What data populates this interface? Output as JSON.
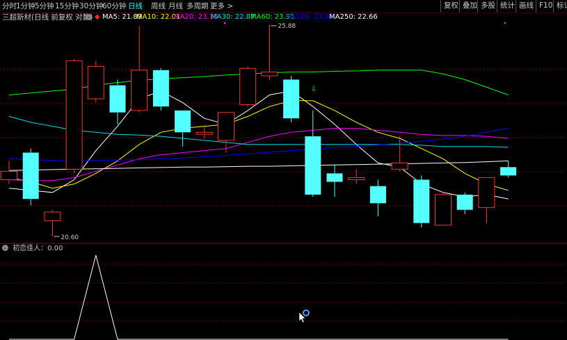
{
  "toolbar": {
    "periods": [
      "分时",
      "1分钟",
      "5分钟",
      "15分钟",
      "30分钟",
      "60分钟",
      "日线",
      "周线",
      "月线",
      "多周期",
      "更多 >"
    ],
    "active_period": "日线",
    "right_buttons": [
      "复权",
      "叠加",
      "多股",
      "统计",
      "画线",
      "F10",
      "标记"
    ]
  },
  "header": {
    "stock_title": "三超新材(日线 前复权 对数)",
    "ma": [
      {
        "label": "MA5: 21.89",
        "color": "#ffffff"
      },
      {
        "label": "MA10: 22.01",
        "color": "#ffff00"
      },
      {
        "label": "MA20: 23.10",
        "color": "#ff00ff"
      },
      {
        "label": "MA30: 22.87",
        "color": "#00e0e0"
      },
      {
        "label": "MA60: 23.91",
        "color": "#00ff00"
      },
      {
        "label": "MA120: 23.96",
        "color": "#0000ff"
      },
      {
        "label": "MA250: 22.66",
        "color": "#ffffff"
      }
    ]
  },
  "colors": {
    "up": "#ff3030",
    "down": "#54ffff",
    "grid": "#7a0000"
  },
  "chart_data": {
    "type": "candlestick",
    "price_axis": "log",
    "max_label": "25.88",
    "min_label": "20.60",
    "candles": [
      {
        "o": 21.9,
        "c": 22.1,
        "h": 22.35,
        "l": 21.8,
        "dir": "up"
      },
      {
        "o": 22.55,
        "c": 21.45,
        "h": 22.65,
        "l": 21.3,
        "dir": "down"
      },
      {
        "o": 20.95,
        "c": 21.15,
        "h": 21.2,
        "l": 20.6,
        "dir": "up"
      },
      {
        "o": 22.15,
        "c": 24.9,
        "h": 24.95,
        "l": 22.05,
        "dir": "up"
      },
      {
        "o": 23.9,
        "c": 24.75,
        "h": 24.9,
        "l": 23.8,
        "dir": "up"
      },
      {
        "o": 24.25,
        "c": 23.55,
        "h": 24.4,
        "l": 23.25,
        "dir": "down"
      },
      {
        "o": 23.6,
        "c": 24.65,
        "h": 25.85,
        "l": 23.55,
        "dir": "up"
      },
      {
        "o": 24.65,
        "c": 23.7,
        "h": 24.7,
        "l": 23.6,
        "dir": "down"
      },
      {
        "o": 23.6,
        "c": 23.05,
        "h": 23.6,
        "l": 22.7,
        "dir": "down"
      },
      {
        "o": 23.0,
        "c": 23.05,
        "h": 23.2,
        "l": 22.9,
        "dir": "up"
      },
      {
        "o": 22.85,
        "c": 23.55,
        "h": 23.55,
        "l": 22.55,
        "dir": "up"
      },
      {
        "o": 23.75,
        "c": 24.7,
        "h": 24.75,
        "l": 23.7,
        "dir": "up"
      },
      {
        "o": 24.5,
        "c": 24.6,
        "h": 25.88,
        "l": 24.4,
        "dir": "up"
      },
      {
        "o": 24.4,
        "c": 23.4,
        "h": 24.5,
        "l": 23.3,
        "dir": "down"
      },
      {
        "o": 22.95,
        "c": 21.55,
        "h": 23.6,
        "l": 21.5,
        "dir": "down"
      },
      {
        "o": 22.05,
        "c": 21.85,
        "h": 22.25,
        "l": 21.5,
        "dir": "down"
      },
      {
        "o": 21.9,
        "c": 21.95,
        "h": 22.15,
        "l": 21.8,
        "dir": "up"
      },
      {
        "o": 21.75,
        "c": 21.35,
        "h": 21.9,
        "l": 21.05,
        "dir": "down"
      },
      {
        "o": 22.15,
        "c": 22.3,
        "h": 22.95,
        "l": 22.1,
        "dir": "up"
      },
      {
        "o": 21.9,
        "c": 20.9,
        "h": 22.0,
        "l": 20.8,
        "dir": "down"
      },
      {
        "o": 20.85,
        "c": 21.55,
        "h": 21.6,
        "l": 20.85,
        "dir": "up"
      },
      {
        "o": 21.55,
        "c": 21.2,
        "h": 21.6,
        "l": 21.1,
        "dir": "down"
      },
      {
        "o": 21.25,
        "c": 21.95,
        "h": 21.95,
        "l": 20.9,
        "dir": "up"
      },
      {
        "o": 22.2,
        "c": 22.0,
        "h": 22.35,
        "l": 21.95,
        "dir": "down"
      }
    ],
    "ma_lines": [
      {
        "name": "MA5",
        "color": "#ffffff",
        "values": [
          21.7,
          21.65,
          21.6,
          21.9,
          22.6,
          23.2,
          23.9,
          24.1,
          23.8,
          23.4,
          23.25,
          23.6,
          24.0,
          24.1,
          23.7,
          23.25,
          22.75,
          22.3,
          22.2,
          21.8,
          21.6,
          21.5,
          21.55,
          21.45
        ]
      },
      {
        "name": "MA10",
        "color": "#ffff00",
        "values": [
          21.95,
          21.85,
          21.7,
          21.8,
          22.05,
          22.35,
          22.75,
          23.05,
          23.15,
          23.2,
          23.25,
          23.45,
          23.7,
          23.85,
          23.85,
          23.6,
          23.3,
          23.05,
          22.9,
          22.65,
          22.4,
          22.05,
          21.8,
          21.65
        ]
      },
      {
        "name": "MA20",
        "color": "#ff00ff",
        "values": [
          21.9,
          21.88,
          21.88,
          21.95,
          22.1,
          22.25,
          22.4,
          22.5,
          22.55,
          22.6,
          22.65,
          22.8,
          22.95,
          23.05,
          23.1,
          23.15,
          23.15,
          23.1,
          23.05,
          23.0,
          22.97,
          22.97,
          22.95,
          22.9
        ]
      },
      {
        "name": "MA30",
        "color": "#00e0e0",
        "values": [
          23.45,
          23.3,
          23.2,
          23.1,
          23.05,
          23.0,
          22.98,
          22.95,
          22.9,
          22.85,
          22.8,
          22.75,
          22.75,
          22.75,
          22.75,
          22.75,
          22.75,
          22.75,
          22.75,
          22.73,
          22.7,
          22.7,
          22.7,
          22.68
        ]
      },
      {
        "name": "MA60",
        "color": "#00ff00",
        "values": [
          24.0,
          24.05,
          24.1,
          24.15,
          24.25,
          24.32,
          24.38,
          24.42,
          24.45,
          24.48,
          24.52,
          24.55,
          24.58,
          24.6,
          24.6,
          24.62,
          24.63,
          24.65,
          24.65,
          24.65,
          24.55,
          24.4,
          24.2,
          24.0
        ]
      },
      {
        "name": "MA120",
        "color": "#0000ff",
        "values": [
          22.4,
          22.38,
          22.36,
          22.35,
          22.36,
          22.37,
          22.38,
          22.4,
          22.42,
          22.45,
          22.48,
          22.52,
          22.56,
          22.6,
          22.63,
          22.67,
          22.7,
          22.74,
          22.78,
          22.83,
          22.88,
          22.95,
          23.05,
          23.15
        ]
      },
      {
        "name": "MA250",
        "color": "#ffffff",
        "values": [
          22.12,
          22.13,
          22.14,
          22.15,
          22.16,
          22.17,
          22.18,
          22.19,
          22.2,
          22.2,
          22.21,
          22.22,
          22.22,
          22.23,
          22.24,
          22.25,
          22.26,
          22.27,
          22.28,
          22.29,
          22.3,
          22.31,
          22.33,
          22.35
        ]
      }
    ]
  },
  "indicator": {
    "title": "初恋佳人：0.00",
    "values": [
      0,
      0,
      0,
      0,
      1,
      0,
      0,
      0,
      0,
      0,
      0,
      0,
      0,
      0,
      0,
      0,
      0,
      0,
      0,
      0,
      0,
      0,
      0,
      0
    ]
  }
}
